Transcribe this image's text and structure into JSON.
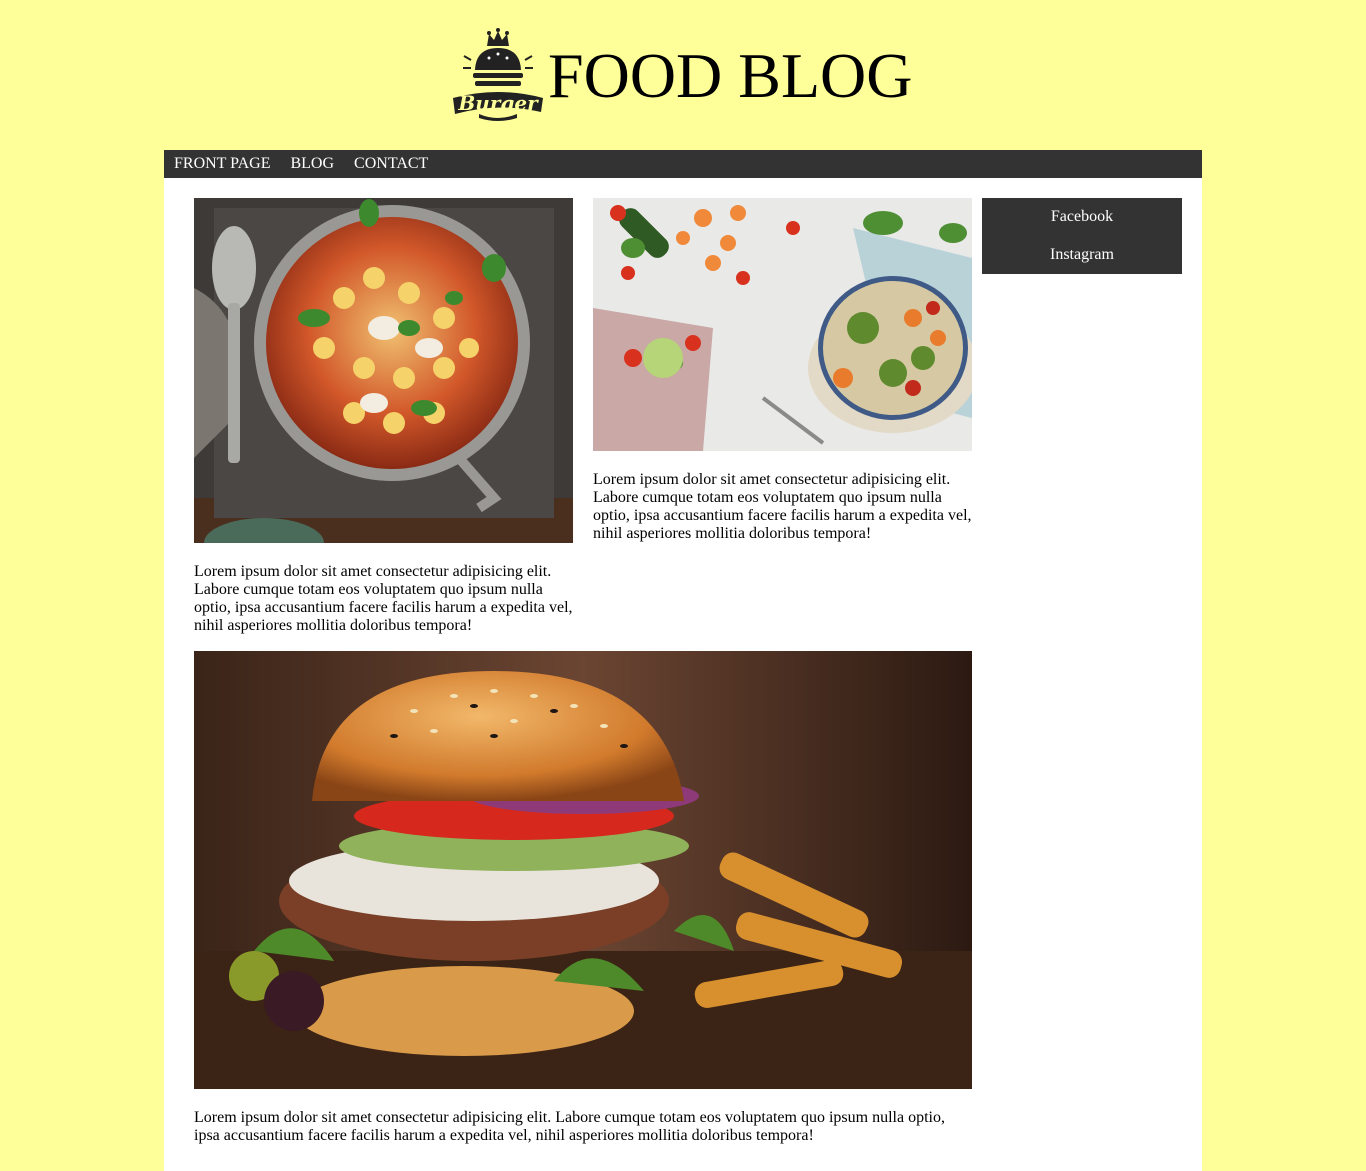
{
  "header": {
    "title": "FOOD BLOG",
    "logo_text": "Burger"
  },
  "nav": {
    "items": [
      {
        "label": "FRONT PAGE"
      },
      {
        "label": "BLOG"
      },
      {
        "label": "CONTACT"
      }
    ]
  },
  "posts": [
    {
      "image": "gnocchi-pan-photo",
      "text": "Lorem ipsum dolor sit amet consectetur adipisicing elit. Labore cumque totam eos voluptatem quo ipsum nulla optio, ipsa accusantium facere facilis harum a expedita vel, nihil asperiores mollitia doloribus tempora!"
    },
    {
      "image": "vegetable-salad-bowl-photo",
      "text": "Lorem ipsum dolor sit amet consectetur adipisicing elit. Labore cumque totam eos voluptatem quo ipsum nulla optio, ipsa accusantium facere facilis harum a expedita vel, nihil asperiores mollitia doloribus tempora!"
    },
    {
      "image": "burger-with-fries-photo",
      "text": "Lorem ipsum dolor sit amet consectetur adipisicing elit. Labore cumque totam eos voluptatem quo ipsum nulla optio, ipsa accusantium facere facilis harum a expedita vel, nihil asperiores mollitia doloribus tempora!"
    }
  ],
  "social": {
    "facebook": "Facebook",
    "instagram": "Instagram"
  },
  "colors": {
    "page_background": "#ffff99",
    "nav_background": "#333333",
    "content_background": "#ffffff"
  }
}
